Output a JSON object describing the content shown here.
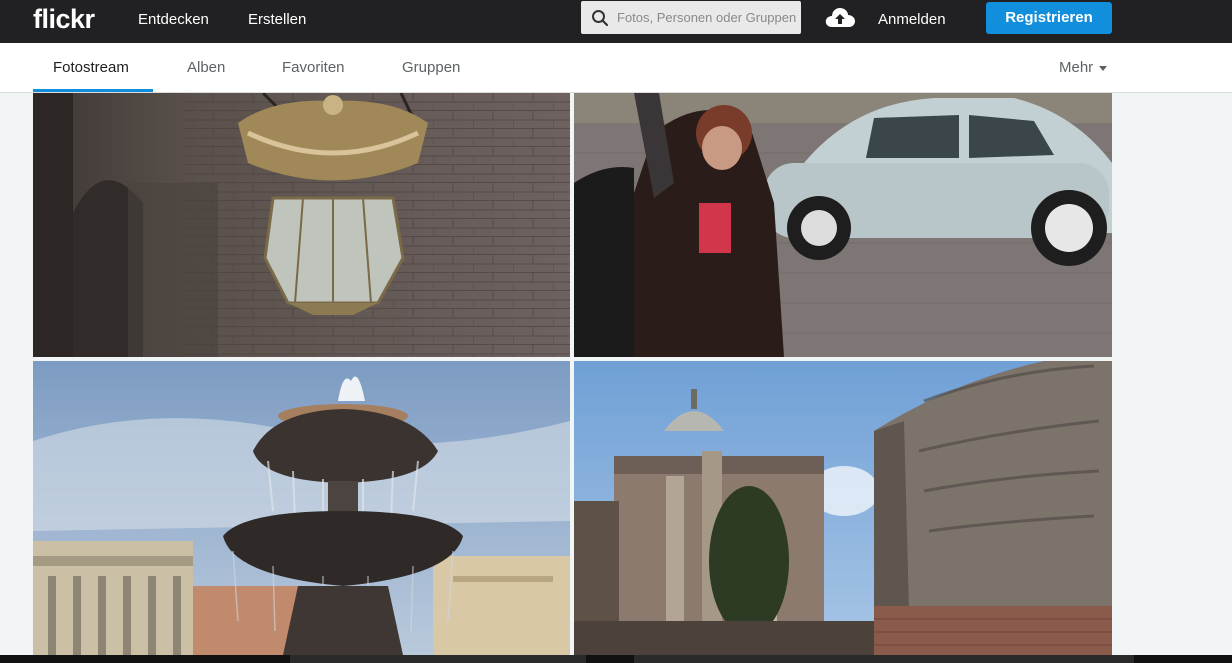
{
  "header": {
    "logo_text": "flickr",
    "nav": [
      "Entdecken",
      "Erstellen"
    ],
    "search_placeholder": "Fotos, Personen oder Gruppen",
    "signin_label": "Anmelden",
    "register_label": "Registrieren"
  },
  "subnav": {
    "tabs": [
      "Fotostream",
      "Alben",
      "Favoriten",
      "Gruppen"
    ],
    "active_tab": "Fotostream",
    "more_label": "Mehr"
  },
  "colors": {
    "topbar": "#212124",
    "accent": "#128fdc"
  },
  "photos": [
    {
      "subject": "ornate-hanging-lantern"
    },
    {
      "subject": "woman-and-vw-beetle"
    },
    {
      "subject": "st-peters-square-fountain"
    },
    {
      "subject": "roman-forum-ruins-inscription"
    }
  ]
}
